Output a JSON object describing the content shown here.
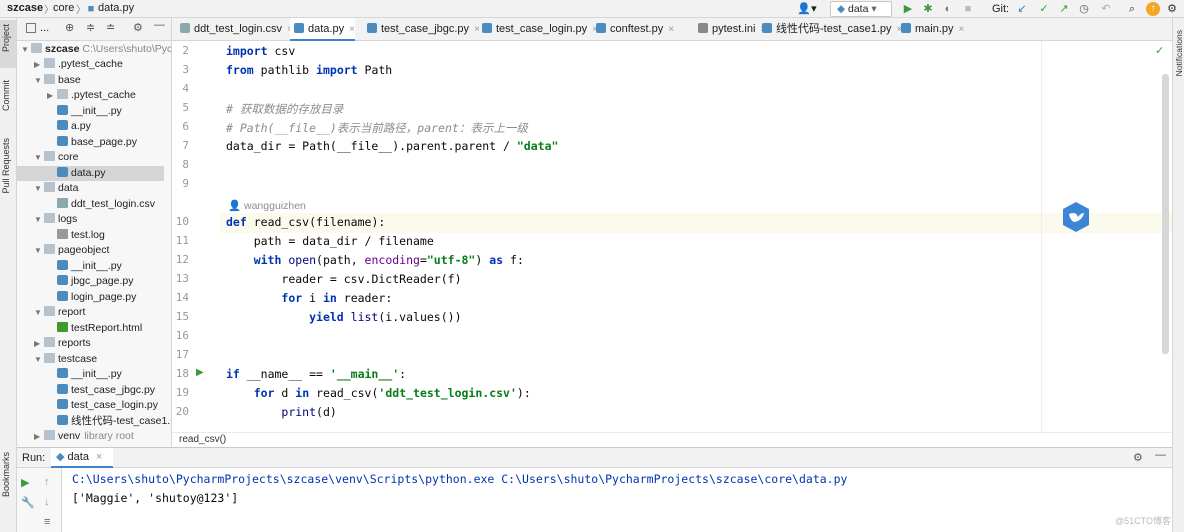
{
  "toolbar": {
    "breadcrumb": [
      "szcase",
      "core",
      "data.py"
    ],
    "run_config": "data",
    "git_label": "Git:"
  },
  "sidebar_tabs": [
    "Project",
    "Commit",
    "Pull Requests",
    "Bookmarks"
  ],
  "right_tabs": [
    "Notifications"
  ],
  "project": {
    "header_label": "...",
    "root_name": "szcase",
    "root_path": "C:\\Users\\shuto\\Pyc",
    "tree": [
      {
        "label": ".pytest_cache",
        "kind": "folder",
        "depth": 1,
        "expanded": false
      },
      {
        "label": "base",
        "kind": "folder",
        "depth": 1,
        "expanded": true
      },
      {
        "label": ".pytest_cache",
        "kind": "folder",
        "depth": 2,
        "expanded": false
      },
      {
        "label": "__init__.py",
        "kind": "py",
        "depth": 2
      },
      {
        "label": "a.py",
        "kind": "py",
        "depth": 2
      },
      {
        "label": "base_page.py",
        "kind": "py",
        "depth": 2
      },
      {
        "label": "core",
        "kind": "folder",
        "depth": 1,
        "expanded": true
      },
      {
        "label": "data.py",
        "kind": "py",
        "depth": 2,
        "selected": true
      },
      {
        "label": "data",
        "kind": "folder",
        "depth": 1,
        "expanded": true
      },
      {
        "label": "ddt_test_login.csv",
        "kind": "csv",
        "depth": 2
      },
      {
        "label": "logs",
        "kind": "folder",
        "depth": 1,
        "expanded": true
      },
      {
        "label": "test.log",
        "kind": "log",
        "depth": 2
      },
      {
        "label": "pageobject",
        "kind": "folder",
        "depth": 1,
        "expanded": true
      },
      {
        "label": "__init__.py",
        "kind": "py",
        "depth": 2
      },
      {
        "label": "jbgc_page.py",
        "kind": "py",
        "depth": 2
      },
      {
        "label": "login_page.py",
        "kind": "py",
        "depth": 2
      },
      {
        "label": "report",
        "kind": "folder",
        "depth": 1,
        "expanded": true
      },
      {
        "label": "testReport.html",
        "kind": "html",
        "depth": 2
      },
      {
        "label": "reports",
        "kind": "folder",
        "depth": 1,
        "expanded": false
      },
      {
        "label": "testcase",
        "kind": "folder",
        "depth": 1,
        "expanded": true
      },
      {
        "label": "__init__.py",
        "kind": "py",
        "depth": 2
      },
      {
        "label": "test_case_jbgc.py",
        "kind": "py",
        "depth": 2
      },
      {
        "label": "test_case_login.py",
        "kind": "py",
        "depth": 2
      },
      {
        "label": "线性代码-test_case1.p",
        "kind": "py",
        "depth": 2
      },
      {
        "label": "venv",
        "kind": "folder",
        "depth": 1,
        "expanded": false,
        "suffix": "library root"
      }
    ]
  },
  "tabs": [
    {
      "label": "ddt_test_login.csv",
      "active": false
    },
    {
      "label": "data.py",
      "active": true
    },
    {
      "label": "test_case_jbgc.py",
      "active": false
    },
    {
      "label": "test_case_login.py",
      "active": false
    },
    {
      "label": "conftest.py",
      "active": false
    },
    {
      "label": "pytest.ini",
      "active": false
    },
    {
      "label": "线性代码-test_case1.py",
      "active": false
    },
    {
      "label": "main.py",
      "active": false
    }
  ],
  "editor": {
    "line_numbers": [
      "2",
      "3",
      "4",
      "5",
      "6",
      "7",
      "8",
      "9",
      "10",
      "11",
      "12",
      "13",
      "14",
      "15",
      "16",
      "17",
      "18",
      "19",
      "20"
    ],
    "author": "wangguizhen",
    "lines": [
      "import csv",
      "from pathlib import Path",
      "",
      "# 获取数据的存放目录",
      "# Path(__file__)表示当前路径，parent：表示上一级",
      "data_dir = Path(__file__).parent.parent / \"data\"",
      "",
      "",
      "def read_csv(filename):",
      "    path = data_dir / filename",
      "    with open(path, encoding=\"utf-8\") as f:",
      "        reader = csv.DictReader(f)",
      "        for i in reader:",
      "            yield list(i.values())",
      "",
      "",
      "if __name__ == '__main__':",
      "    for d in read_csv('ddt_test_login.csv'):",
      "        print(d)"
    ],
    "status_crumb": "read_csv()"
  },
  "run": {
    "label": "Run:",
    "tab": "data",
    "output": [
      "C:\\Users\\shuto\\PycharmProjects\\szcase\\venv\\Scripts\\python.exe C:\\Users\\shuto\\PycharmProjects\\szcase\\core\\data.py",
      "['Maggie', 'shutoy@123']"
    ]
  },
  "watermark": "@51CTO博客",
  "colors": {
    "accent": "#4083c9",
    "keyword": "#0033b3",
    "string": "#067d17",
    "comment": "#8c8c8c",
    "param": "#660099",
    "run_green": "#3c9a3c"
  }
}
